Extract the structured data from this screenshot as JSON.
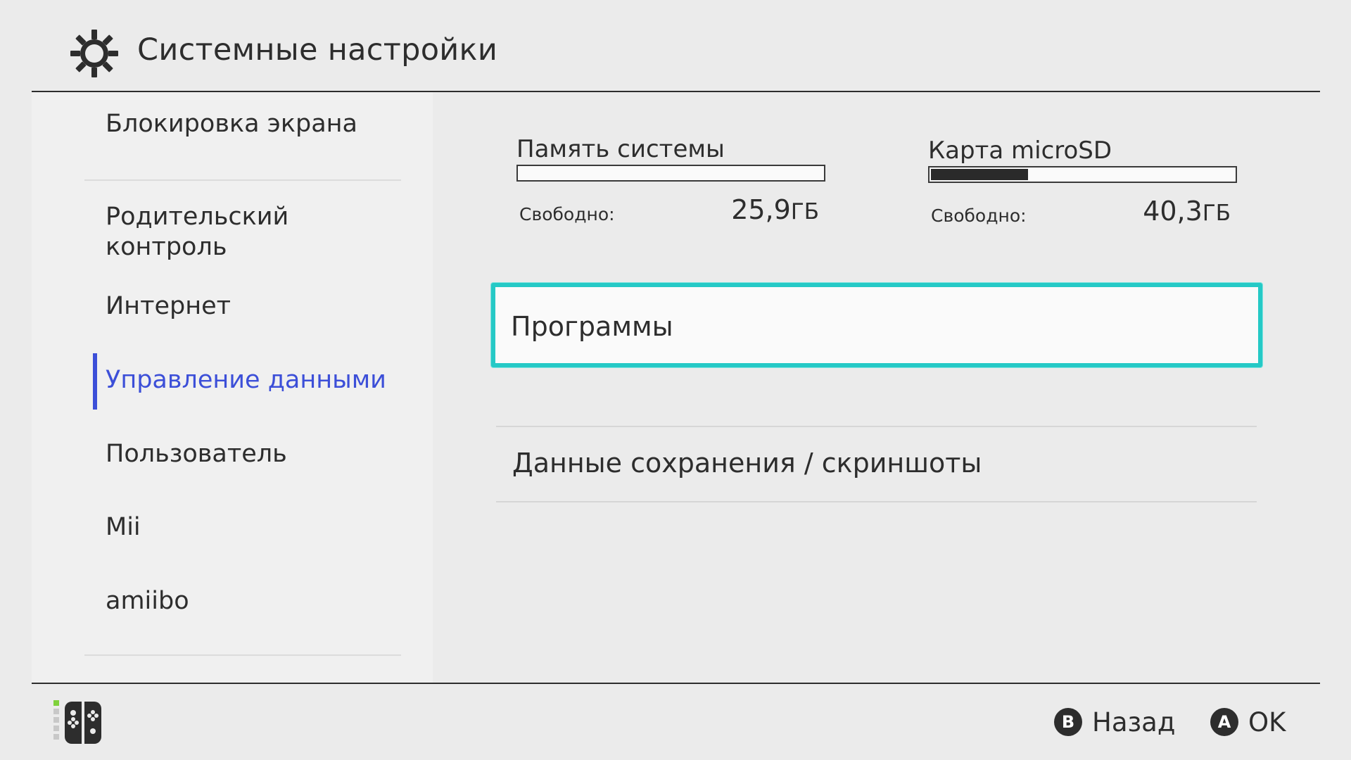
{
  "header": {
    "title": "Системные настройки",
    "icon": "gear-icon"
  },
  "sidebar": {
    "items": [
      {
        "label": "Блокировка экрана",
        "active": false
      },
      {
        "label": "Родительский",
        "label2": "контроль",
        "active": false
      },
      {
        "label": "Интернет",
        "active": false
      },
      {
        "label": "Управление данными",
        "active": true
      },
      {
        "label": "Пользователь",
        "active": false
      },
      {
        "label": "Mii",
        "active": false
      },
      {
        "label": "amiibo",
        "active": false
      }
    ],
    "active_color": "#3c4fd8"
  },
  "storage": {
    "system": {
      "title": "Память системы",
      "free_label": "Свободно:",
      "free_value": "25,9",
      "free_unit": "ГБ",
      "used_fraction": 0.0
    },
    "microsd": {
      "title": "Карта microSD",
      "free_label": "Свободно:",
      "free_value": "40,3",
      "free_unit": "ГБ",
      "used_fraction": 0.32
    }
  },
  "menu": {
    "selected": "Программы",
    "items": [
      "Данные сохранения / скриншоты"
    ],
    "highlight_color": "#25c9c6"
  },
  "footer": {
    "controller_icon": "joycon-icon",
    "back": {
      "button": "B",
      "label": "Назад"
    },
    "ok": {
      "button": "A",
      "label": "OK"
    }
  }
}
